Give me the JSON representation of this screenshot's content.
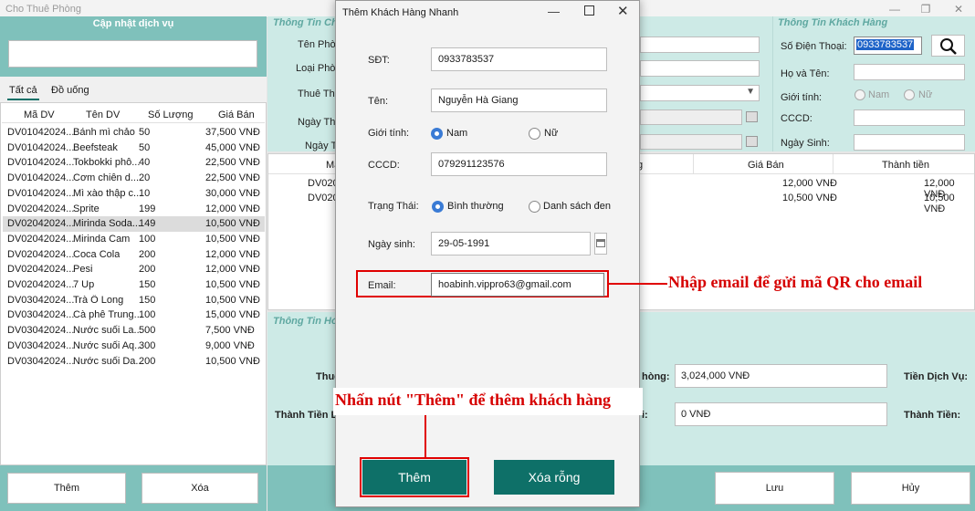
{
  "window": {
    "title": "Cho Thuê Phòng"
  },
  "services": {
    "header": "Cập nhật dịch vụ",
    "search_value": "",
    "tabs": [
      "Tất cả",
      "Đồ uống"
    ],
    "columns": [
      "Mã DV",
      "Tên DV",
      "Số Lượng",
      "Giá Bán"
    ],
    "rows": [
      [
        "DV01042024...",
        "Bánh mì chảo",
        "50",
        "37,500 VNĐ"
      ],
      [
        "DV01042024...",
        "Beefsteak",
        "50",
        "45,000 VNĐ"
      ],
      [
        "DV01042024...",
        "Tokbokki phô...",
        "40",
        "22,500 VNĐ"
      ],
      [
        "DV01042024...",
        "Cơm chiên d...",
        "20",
        "22,500 VNĐ"
      ],
      [
        "DV01042024...",
        "Mì xào thập c...",
        "10",
        "30,000 VNĐ"
      ],
      [
        "DV02042024...",
        "Sprite",
        "199",
        "12,000 VNĐ"
      ],
      [
        "DV02042024...",
        "Mirinda Soda...",
        "149",
        "10,500 VNĐ"
      ],
      [
        "DV02042024...",
        "Mirinda Cam",
        "100",
        "10,500 VNĐ"
      ],
      [
        "DV02042024...",
        "Coca Cola",
        "200",
        "12,000 VNĐ"
      ],
      [
        "DV02042024...",
        "Pesi",
        "200",
        "12,000 VNĐ"
      ],
      [
        "DV02042024...",
        "7 Up",
        "150",
        "10,500 VNĐ"
      ],
      [
        "DV03042024...",
        "Trà Ô Long",
        "150",
        "10,500 VNĐ"
      ],
      [
        "DV03042024...",
        "Cà phê Trung...",
        "100",
        "15,000 VNĐ"
      ],
      [
        "DV03042024...",
        "Nước suối La...",
        "500",
        "7,500 VNĐ"
      ],
      [
        "DV03042024...",
        "Nước suối Aq...",
        "300",
        "9,000 VNĐ"
      ],
      [
        "DV03042024...",
        "Nước suối Da...",
        "200",
        "10,500 VNĐ"
      ]
    ],
    "add_label": "Thêm",
    "delete_label": "Xóa"
  },
  "room": {
    "title": "Thông Tin Chi",
    "labels": [
      "Tên Phòn",
      "Loại Phòn",
      "Thuê The",
      "Ngày Thu",
      "Ngày Tr"
    ]
  },
  "mid_table": {
    "columns": [
      "Mã",
      "g",
      "Giá Bán",
      "Thành tiền"
    ],
    "rows": [
      [
        "DV020",
        "12,000 VNĐ",
        "12,000 VNĐ"
      ],
      [
        "DV020",
        "10,500 VNĐ",
        "10,500 VNĐ"
      ]
    ]
  },
  "invoice": {
    "title": "Thông Tin Hóa",
    "label1": "Thuê",
    "label2": "Thành Tiền Ba",
    "room_fee_label": "hòng:",
    "room_fee": "3,024,000 VNĐ",
    "other_label": "i:",
    "other_value": "0 VNĐ",
    "service_label": "Tiền Dịch Vụ:",
    "total_label": "Thành Tiền:"
  },
  "customer": {
    "title": "Thông Tin Khách Hàng",
    "phone_label": "Số Điện Thoại:",
    "phone_value": "0933783537",
    "name_label": "Họ và Tên:",
    "gender_label": "Giới tính:",
    "gender_male": "Nam",
    "gender_female": "Nữ",
    "id_label": "CCCD:",
    "dob_label": "Ngày Sinh:",
    "save_label": "Lưu",
    "cancel_label": "Hủy"
  },
  "modal": {
    "title": "Thêm Khách Hàng Nhanh",
    "phone_label": "SĐT:",
    "phone_value": "0933783537",
    "name_label": "Tên:",
    "name_value": "Nguyễn Hà Giang",
    "gender_label": "Giới tính:",
    "gender_male": "Nam",
    "gender_female": "Nữ",
    "id_label": "CCCD:",
    "id_value": "079291123576",
    "status_label": "Trạng Thái:",
    "status_normal": "Bình thường",
    "status_black": "Danh sách đen",
    "dob_label": "Ngày sinh:",
    "dob_value": "29-05-1991",
    "email_label": "Email:",
    "email_value": "hoabinh.vippro63@gmail.com",
    "add_label": "Thêm",
    "clear_label": "Xóa rỗng"
  },
  "annotations": {
    "email_note": "Nhập email để gửi mã QR cho email",
    "add_note": "Nhấn nút \"Thêm\" để thêm khách hàng"
  },
  "colors": {
    "accent": "#0e7068",
    "teal": "#7fc1bb",
    "mint": "#cdeae6",
    "annotation": "#e00000"
  }
}
